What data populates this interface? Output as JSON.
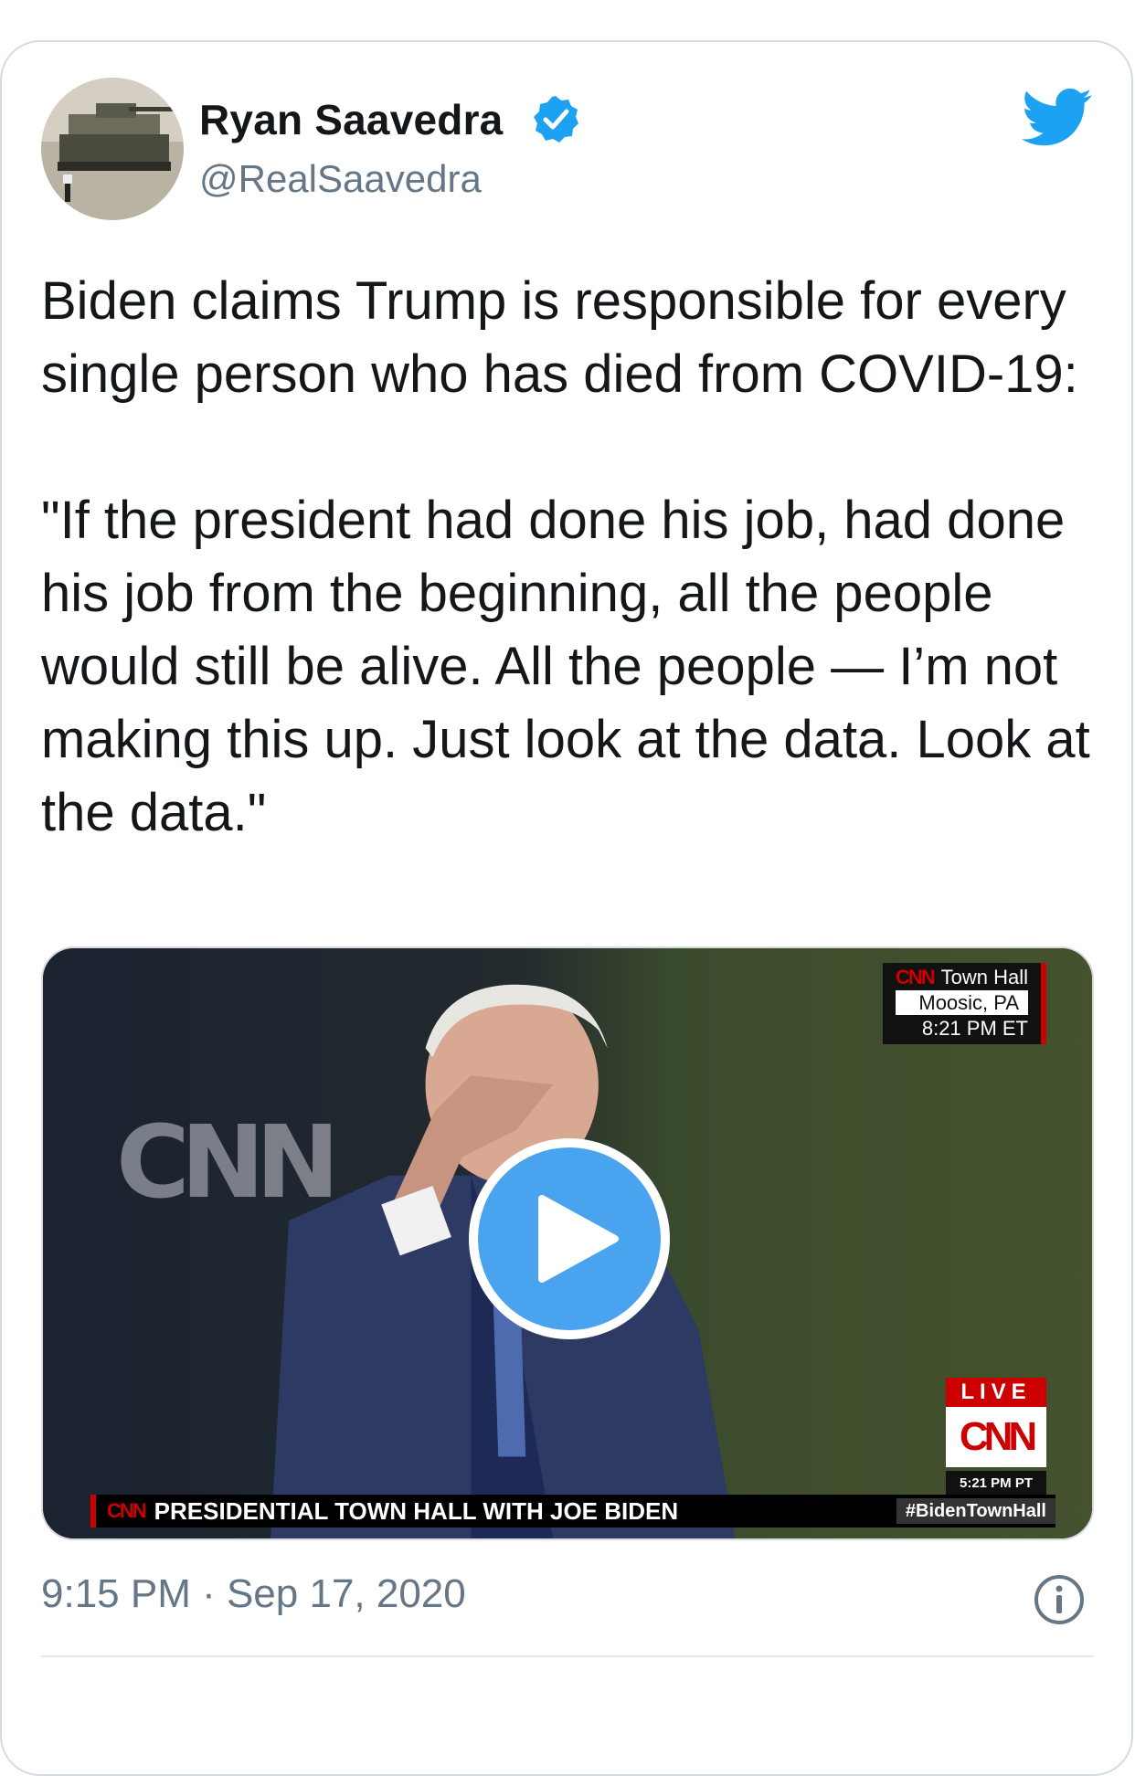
{
  "author": {
    "name": "Ryan Saavedra",
    "handle": "@RealSaavedra",
    "verified": true
  },
  "tweet": {
    "paragraphs": [
      "Biden claims Trump is responsible for every single person who has died from COVID-19:",
      "\"If the president had done his job, had done his job from the beginning, all the people would still be alive. All the people — I’m not making this up. Just look at the data. Look at the data.\""
    ]
  },
  "media": {
    "type": "video",
    "overlay": {
      "network": "CNN",
      "program": "Town Hall",
      "location": "Moosic, PA",
      "time": "8:21 PM ET"
    },
    "live_badge": {
      "label": "LIVE",
      "network": "CNN",
      "time": "5:21 PM PT"
    },
    "lower_third": {
      "network": "CNN",
      "headline": "PRESIDENTIAL TOWN HALL WITH JOE BIDEN",
      "hashtag": "#BidenTownHall"
    },
    "backdrop_text": "CNN"
  },
  "timestamp": "9:15 PM · Sep 17, 2020",
  "icons": {
    "brand": "twitter-bird-icon",
    "verified": "verified-badge-icon",
    "play": "play-icon",
    "info": "info-icon"
  },
  "colors": {
    "accent": "#1da1f2",
    "play": "#4aa3ee",
    "secondary_text": "#657786",
    "cnn_red": "#cc0000"
  }
}
